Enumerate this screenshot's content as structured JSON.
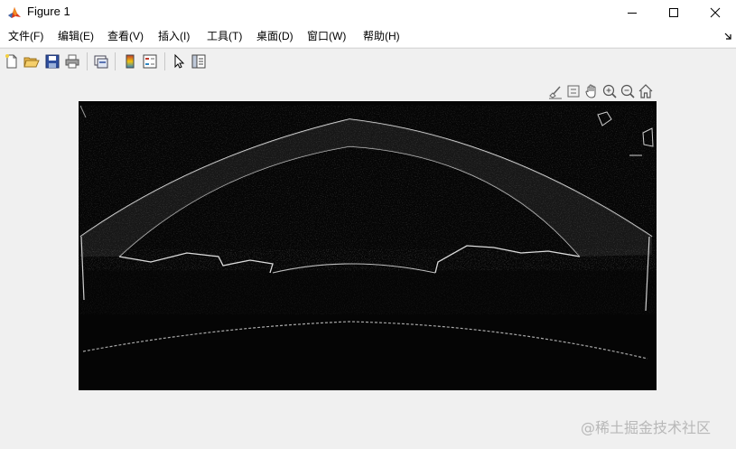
{
  "window": {
    "title": "Figure 1"
  },
  "menu": {
    "items": [
      {
        "label": "文件(F)"
      },
      {
        "label": "编辑(E)"
      },
      {
        "label": "查看(V)"
      },
      {
        "label": "插入(I)"
      },
      {
        "label": "工具(T)"
      },
      {
        "label": "桌面(D)"
      },
      {
        "label": "窗口(W)"
      },
      {
        "label": "帮助(H)"
      }
    ]
  },
  "toolbar": {
    "icons": [
      "new-figure-icon",
      "open-file-icon",
      "save-icon",
      "print-icon",
      "link-plot-icon",
      "colorbar-icon",
      "legend-icon",
      "edit-plot-icon",
      "property-inspector-icon"
    ]
  },
  "axes_toolbar": {
    "icons": [
      "brush-icon",
      "data-tips-icon",
      "pan-icon",
      "zoom-in-icon",
      "zoom-out-icon",
      "home-icon"
    ]
  },
  "figure": {
    "image_description_colors": {
      "background": "#050505",
      "edges": "#e8e8e8"
    }
  },
  "watermark": {
    "text": "@稀土掘金技术社区"
  },
  "colors": {
    "titlebar_bg": "#ffffff",
    "figure_bg": "#f0f0f0",
    "matlab_icon_red": "#d9381e",
    "matlab_icon_blue": "#3c6eb4"
  }
}
